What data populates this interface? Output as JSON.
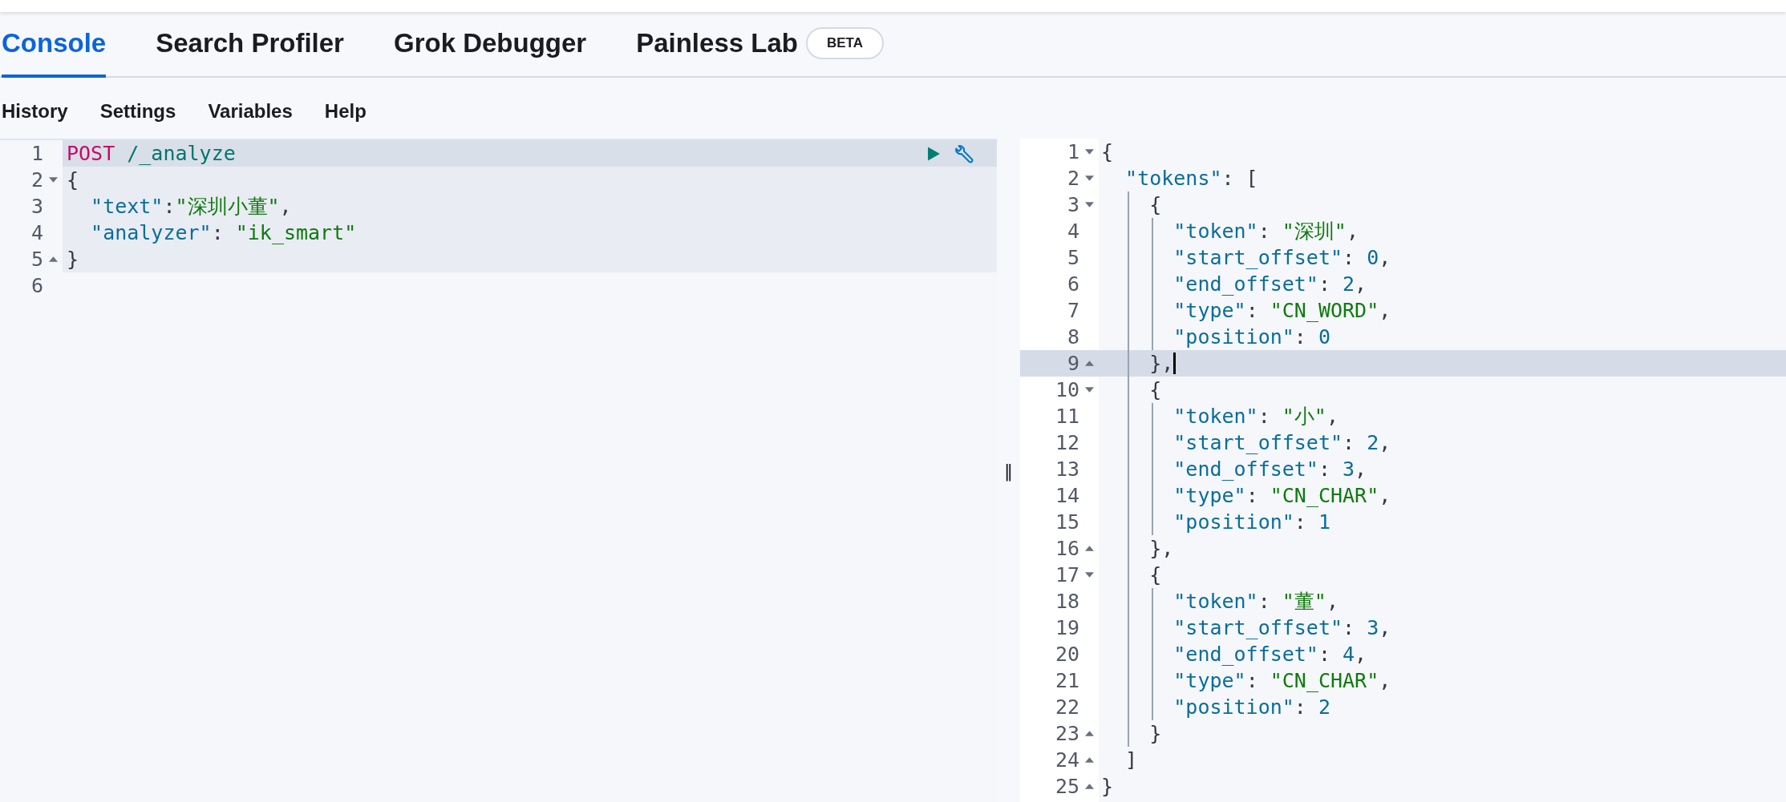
{
  "tabs": [
    {
      "label": "Console",
      "selected": true
    },
    {
      "label": "Search Profiler",
      "selected": false
    },
    {
      "label": "Grok Debugger",
      "selected": false
    },
    {
      "label": "Painless Lab",
      "selected": false,
      "badge": "BETA"
    }
  ],
  "menu": [
    "History",
    "Settings",
    "Variables",
    "Help"
  ],
  "request_editor": {
    "lines": [
      {
        "number": "1",
        "fold_start": false,
        "fold_end": false,
        "active": true,
        "in_request": true,
        "parts": [
          {
            "kind": "method",
            "text": "POST"
          },
          {
            "kind": "url",
            "text": " /_analyze"
          }
        ]
      },
      {
        "number": "2",
        "fold_start": true,
        "fold_end": false,
        "active": false,
        "in_request": true,
        "parts": [
          {
            "kind": "punct",
            "text": "{"
          }
        ]
      },
      {
        "number": "3",
        "fold_start": false,
        "fold_end": false,
        "active": false,
        "in_request": true,
        "parts": [
          {
            "kind": "key",
            "text": "  \"text\""
          },
          {
            "kind": "punct",
            "text": ":"
          },
          {
            "kind": "string",
            "text": "\"深圳小董\""
          },
          {
            "kind": "punct",
            "text": ","
          }
        ]
      },
      {
        "number": "4",
        "fold_start": false,
        "fold_end": false,
        "active": false,
        "in_request": true,
        "parts": [
          {
            "kind": "key",
            "text": "  \"analyzer\""
          },
          {
            "kind": "punct",
            "text": ": "
          },
          {
            "kind": "string",
            "text": "\"ik_smart\""
          }
        ]
      },
      {
        "number": "5",
        "fold_start": false,
        "fold_end": true,
        "active": false,
        "in_request": true,
        "parts": [
          {
            "kind": "punct",
            "text": "}"
          }
        ]
      },
      {
        "number": "6",
        "fold_start": false,
        "fold_end": false,
        "active": false,
        "in_request": false
      }
    ]
  },
  "divider": {
    "label": "‖"
  },
  "response_editor": {
    "lines": [
      {
        "number": "1",
        "fold_start": true,
        "fold_end": false,
        "active": false,
        "cursor": false,
        "parts": [
          {
            "kind": "punct",
            "text": "{"
          }
        ]
      },
      {
        "number": "2",
        "fold_start": true,
        "fold_end": false,
        "active": false,
        "cursor": false,
        "parts": [
          {
            "kind": "key",
            "text": "  \"tokens\""
          },
          {
            "kind": "punct",
            "text": ": ["
          }
        ]
      },
      {
        "number": "3",
        "fold_start": true,
        "fold_end": false,
        "active": false,
        "cursor": false,
        "parts": [
          {
            "kind": "punct",
            "text": "    {"
          }
        ]
      },
      {
        "number": "4",
        "fold_start": false,
        "fold_end": false,
        "active": false,
        "cursor": false,
        "parts": [
          {
            "kind": "key",
            "text": "      \"token\""
          },
          {
            "kind": "punct",
            "text": ": "
          },
          {
            "kind": "string",
            "text": "\"深圳\""
          },
          {
            "kind": "punct",
            "text": ","
          }
        ]
      },
      {
        "number": "5",
        "fold_start": false,
        "fold_end": false,
        "active": false,
        "cursor": false,
        "parts": [
          {
            "kind": "key",
            "text": "      \"start_offset\""
          },
          {
            "kind": "punct",
            "text": ": "
          },
          {
            "kind": "number",
            "text": "0"
          },
          {
            "kind": "punct",
            "text": ","
          }
        ]
      },
      {
        "number": "6",
        "fold_start": false,
        "fold_end": false,
        "active": false,
        "cursor": false,
        "parts": [
          {
            "kind": "key",
            "text": "      \"end_offset\""
          },
          {
            "kind": "punct",
            "text": ": "
          },
          {
            "kind": "number",
            "text": "2"
          },
          {
            "kind": "punct",
            "text": ","
          }
        ]
      },
      {
        "number": "7",
        "fold_start": false,
        "fold_end": false,
        "active": false,
        "cursor": false,
        "parts": [
          {
            "kind": "key",
            "text": "      \"type\""
          },
          {
            "kind": "punct",
            "text": ": "
          },
          {
            "kind": "string",
            "text": "\"CN_WORD\""
          },
          {
            "kind": "punct",
            "text": ","
          }
        ]
      },
      {
        "number": "8",
        "fold_start": false,
        "fold_end": false,
        "active": false,
        "cursor": false,
        "parts": [
          {
            "kind": "key",
            "text": "      \"position\""
          },
          {
            "kind": "punct",
            "text": ": "
          },
          {
            "kind": "number",
            "text": "0"
          }
        ]
      },
      {
        "number": "9",
        "fold_start": false,
        "fold_end": true,
        "active": true,
        "cursor": true,
        "parts": [
          {
            "kind": "punct",
            "text": "    },"
          }
        ]
      },
      {
        "number": "10",
        "fold_start": true,
        "fold_end": false,
        "active": false,
        "cursor": false,
        "parts": [
          {
            "kind": "punct",
            "text": "    {"
          }
        ]
      },
      {
        "number": "11",
        "fold_start": false,
        "fold_end": false,
        "active": false,
        "cursor": false,
        "parts": [
          {
            "kind": "key",
            "text": "      \"token\""
          },
          {
            "kind": "punct",
            "text": ": "
          },
          {
            "kind": "string",
            "text": "\"小\""
          },
          {
            "kind": "punct",
            "text": ","
          }
        ]
      },
      {
        "number": "12",
        "fold_start": false,
        "fold_end": false,
        "active": false,
        "cursor": false,
        "parts": [
          {
            "kind": "key",
            "text": "      \"start_offset\""
          },
          {
            "kind": "punct",
            "text": ": "
          },
          {
            "kind": "number",
            "text": "2"
          },
          {
            "kind": "punct",
            "text": ","
          }
        ]
      },
      {
        "number": "13",
        "fold_start": false,
        "fold_end": false,
        "active": false,
        "cursor": false,
        "parts": [
          {
            "kind": "key",
            "text": "      \"end_offset\""
          },
          {
            "kind": "punct",
            "text": ": "
          },
          {
            "kind": "number",
            "text": "3"
          },
          {
            "kind": "punct",
            "text": ","
          }
        ]
      },
      {
        "number": "14",
        "fold_start": false,
        "fold_end": false,
        "active": false,
        "cursor": false,
        "parts": [
          {
            "kind": "key",
            "text": "      \"type\""
          },
          {
            "kind": "punct",
            "text": ": "
          },
          {
            "kind": "string",
            "text": "\"CN_CHAR\""
          },
          {
            "kind": "punct",
            "text": ","
          }
        ]
      },
      {
        "number": "15",
        "fold_start": false,
        "fold_end": false,
        "active": false,
        "cursor": false,
        "parts": [
          {
            "kind": "key",
            "text": "      \"position\""
          },
          {
            "kind": "punct",
            "text": ": "
          },
          {
            "kind": "number",
            "text": "1"
          }
        ]
      },
      {
        "number": "16",
        "fold_start": false,
        "fold_end": true,
        "active": false,
        "cursor": false,
        "parts": [
          {
            "kind": "punct",
            "text": "    },"
          }
        ]
      },
      {
        "number": "17",
        "fold_start": true,
        "fold_end": false,
        "active": false,
        "cursor": false,
        "parts": [
          {
            "kind": "punct",
            "text": "    {"
          }
        ]
      },
      {
        "number": "18",
        "fold_start": false,
        "fold_end": false,
        "active": false,
        "cursor": false,
        "parts": [
          {
            "kind": "key",
            "text": "      \"token\""
          },
          {
            "kind": "punct",
            "text": ": "
          },
          {
            "kind": "string",
            "text": "\"董\""
          },
          {
            "kind": "punct",
            "text": ","
          }
        ]
      },
      {
        "number": "19",
        "fold_start": false,
        "fold_end": false,
        "active": false,
        "cursor": false,
        "parts": [
          {
            "kind": "key",
            "text": "      \"start_offset\""
          },
          {
            "kind": "punct",
            "text": ": "
          },
          {
            "kind": "number",
            "text": "3"
          },
          {
            "kind": "punct",
            "text": ","
          }
        ]
      },
      {
        "number": "20",
        "fold_start": false,
        "fold_end": false,
        "active": false,
        "cursor": false,
        "parts": [
          {
            "kind": "key",
            "text": "      \"end_offset\""
          },
          {
            "kind": "punct",
            "text": ": "
          },
          {
            "kind": "number",
            "text": "4"
          },
          {
            "kind": "punct",
            "text": ","
          }
        ]
      },
      {
        "number": "21",
        "fold_start": false,
        "fold_end": false,
        "active": false,
        "cursor": false,
        "parts": [
          {
            "kind": "key",
            "text": "      \"type\""
          },
          {
            "kind": "punct",
            "text": ": "
          },
          {
            "kind": "string",
            "text": "\"CN_CHAR\""
          },
          {
            "kind": "punct",
            "text": ","
          }
        ]
      },
      {
        "number": "22",
        "fold_start": false,
        "fold_end": false,
        "active": false,
        "cursor": false,
        "parts": [
          {
            "kind": "key",
            "text": "      \"position\""
          },
          {
            "kind": "punct",
            "text": ": "
          },
          {
            "kind": "number",
            "text": "2"
          }
        ]
      },
      {
        "number": "23",
        "fold_start": false,
        "fold_end": true,
        "active": false,
        "cursor": false,
        "parts": [
          {
            "kind": "punct",
            "text": "    }"
          }
        ]
      },
      {
        "number": "24",
        "fold_start": false,
        "fold_end": true,
        "active": false,
        "cursor": false,
        "parts": [
          {
            "kind": "punct",
            "text": "  ]"
          }
        ]
      },
      {
        "number": "25",
        "fold_start": false,
        "fold_end": true,
        "active": false,
        "cursor": false,
        "parts": [
          {
            "kind": "punct",
            "text": "}"
          }
        ]
      }
    ]
  }
}
